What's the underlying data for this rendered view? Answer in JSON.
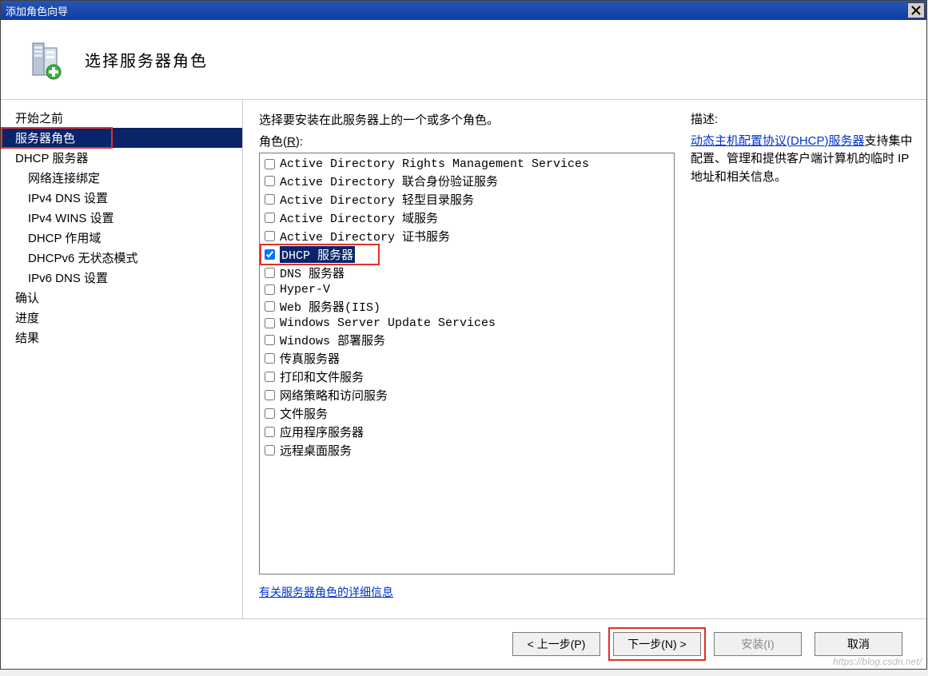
{
  "window": {
    "title": "添加角色向导"
  },
  "header": {
    "title": "选择服务器角色"
  },
  "sidebar": {
    "items": [
      {
        "label": "开始之前",
        "sub": false,
        "selected": false
      },
      {
        "label": "服务器角色",
        "sub": false,
        "selected": true,
        "highlight": true
      },
      {
        "label": "DHCP 服务器",
        "sub": false,
        "selected": false
      },
      {
        "label": "网络连接绑定",
        "sub": true,
        "selected": false
      },
      {
        "label": "IPv4 DNS 设置",
        "sub": true,
        "selected": false
      },
      {
        "label": "IPv4 WINS 设置",
        "sub": true,
        "selected": false
      },
      {
        "label": "DHCP 作用域",
        "sub": true,
        "selected": false
      },
      {
        "label": "DHCPv6 无状态模式",
        "sub": true,
        "selected": false
      },
      {
        "label": "IPv6 DNS 设置",
        "sub": true,
        "selected": false
      },
      {
        "label": "确认",
        "sub": false,
        "selected": false
      },
      {
        "label": "进度",
        "sub": false,
        "selected": false
      },
      {
        "label": "结果",
        "sub": false,
        "selected": false
      }
    ]
  },
  "content": {
    "instruction": "选择要安装在此服务器上的一个或多个角色。",
    "roles_label_prefix": "角色(",
    "roles_label_hotkey": "R",
    "roles_label_suffix": "):",
    "roles": [
      {
        "label": "Active Directory Rights Management Services",
        "checked": false
      },
      {
        "label": "Active Directory 联合身份验证服务",
        "checked": false
      },
      {
        "label": "Active Directory 轻型目录服务",
        "checked": false
      },
      {
        "label": "Active Directory 域服务",
        "checked": false
      },
      {
        "label": "Active Directory 证书服务",
        "checked": false
      },
      {
        "label": "DHCP 服务器",
        "checked": true,
        "selected": true,
        "highlight": true
      },
      {
        "label": "DNS 服务器",
        "checked": false
      },
      {
        "label": "Hyper-V",
        "checked": false
      },
      {
        "label": "Web 服务器(IIS)",
        "checked": false
      },
      {
        "label": "Windows Server Update Services",
        "checked": false
      },
      {
        "label": "Windows 部署服务",
        "checked": false
      },
      {
        "label": "传真服务器",
        "checked": false
      },
      {
        "label": "打印和文件服务",
        "checked": false
      },
      {
        "label": "网络策略和访问服务",
        "checked": false
      },
      {
        "label": "文件服务",
        "checked": false
      },
      {
        "label": "应用程序服务器",
        "checked": false
      },
      {
        "label": "远程桌面服务",
        "checked": false
      }
    ],
    "more_info_link": "有关服务器角色的详细信息",
    "desc_heading": "描述:",
    "desc_link": "动态主机配置协议(DHCP)服务器",
    "desc_tail": "支持集中配置、管理和提供客户端计算机的临时 IP 地址和相关信息。"
  },
  "footer": {
    "back": "< 上一步(P)",
    "next": "下一步(N) >",
    "install": "安装(I)",
    "cancel": "取消"
  },
  "watermark": "https://blog.csdn.net/"
}
